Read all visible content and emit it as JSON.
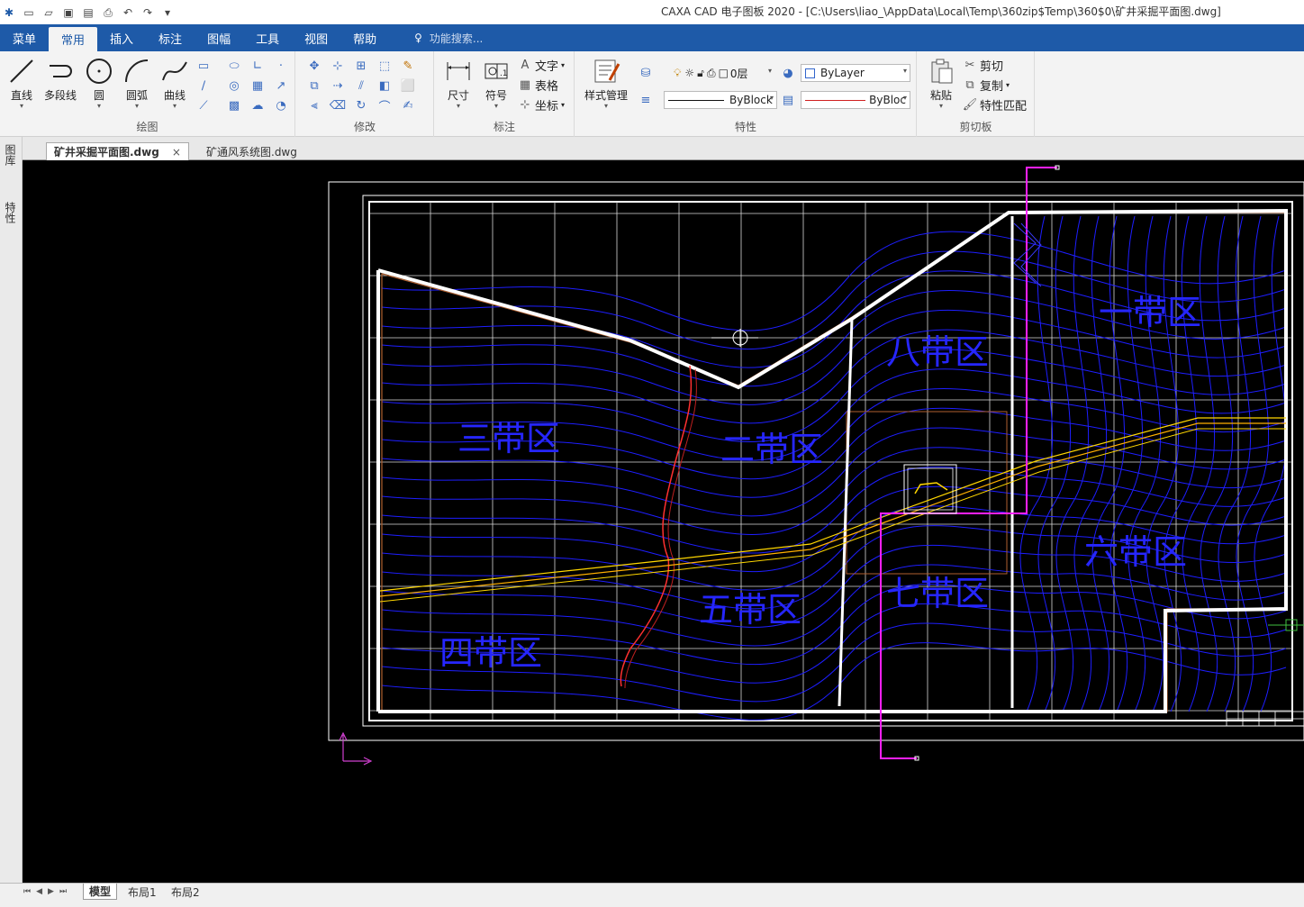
{
  "titlebar": {
    "title": "CAXA CAD 电子图板 2020 - [C:\\Users\\liao_\\AppData\\Local\\Temp\\360zip$Temp\\360$0\\矿井采掘平面图.dwg]"
  },
  "menu": {
    "tabs": [
      "菜单",
      "常用",
      "插入",
      "标注",
      "图幅",
      "工具",
      "视图",
      "帮助"
    ],
    "active": "常用",
    "search_placeholder": "功能搜索..."
  },
  "ribbon": {
    "draw": {
      "label": "绘图",
      "line": "直线",
      "polyline": "多段线",
      "circle": "圆",
      "arc": "圆弧",
      "curve": "曲线"
    },
    "modify": {
      "label": "修改"
    },
    "annotate": {
      "label": "标注",
      "dimension": "尺寸",
      "symbol": "符号",
      "text": "文字",
      "table": "表格",
      "coord": "坐标"
    },
    "properties": {
      "label": "特性",
      "style_manager": "样式管理",
      "layer": "0层",
      "color": "ByLayer",
      "linetype": "ByBlock",
      "lineweight": "ByBloc"
    },
    "clipboard": {
      "label": "剪切板",
      "paste": "粘贴",
      "cut": "剪切",
      "copy": "复制",
      "match": "特性匹配"
    }
  },
  "leftpalette": {
    "library": "图库",
    "props": "特性"
  },
  "doctabs": {
    "tab1": "矿井采掘平面图.dwg",
    "tab2": "矿通风系统图.dwg",
    "close": "×"
  },
  "drawing": {
    "labels": [
      "一带区",
      "二带区",
      "三带区",
      "四带区",
      "五带区",
      "六带区",
      "七带区",
      "八带区"
    ]
  },
  "status": {
    "layouts": [
      "模型",
      "布局1",
      "布局2"
    ]
  }
}
